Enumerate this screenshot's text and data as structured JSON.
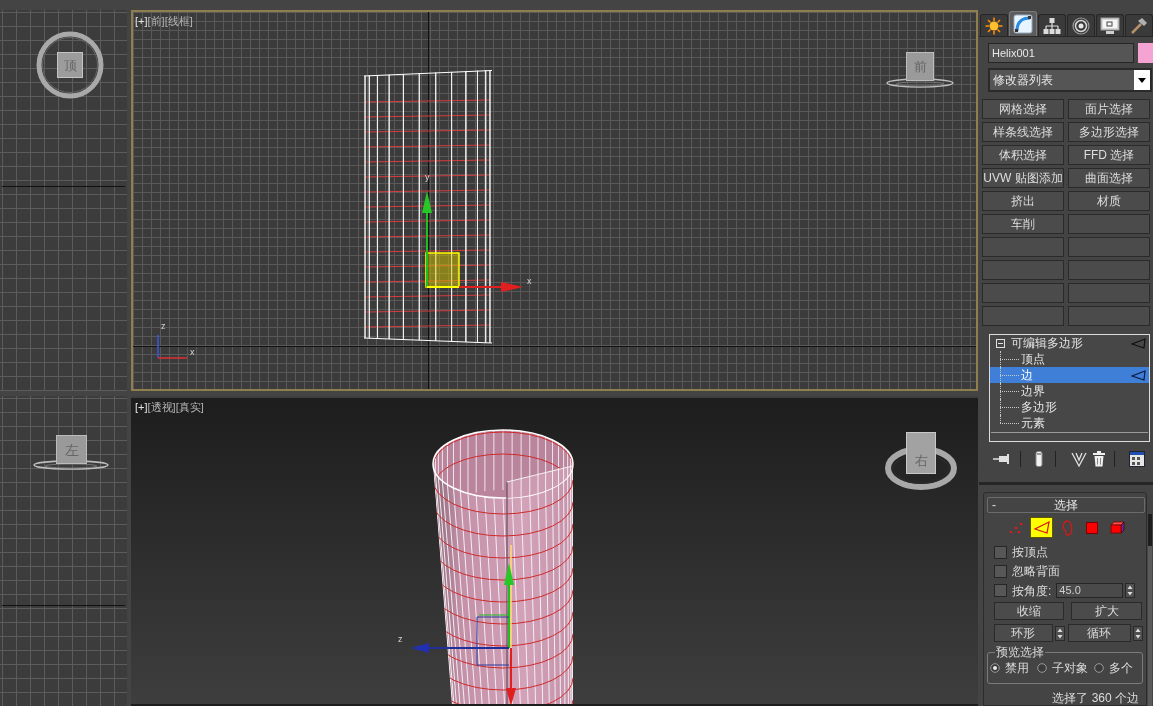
{
  "viewports": [
    {
      "kind": "top",
      "active": false,
      "viewcube_label": "顶"
    },
    {
      "kind": "front",
      "active": true,
      "menu_labels": [
        "[+]",
        "[前]",
        "[线框]"
      ],
      "viewcube_label": "前",
      "gizmo_labels": [
        "y",
        "x"
      ],
      "axis_labels": [
        "z",
        "x"
      ]
    },
    {
      "kind": "left",
      "active": false,
      "viewcube_label": "左"
    },
    {
      "kind": "perspective",
      "active": false,
      "menu_labels": [
        "[+]",
        "[透视]",
        "[真实]"
      ],
      "viewcube_label": "右",
      "gizmo_labels": [
        "z"
      ]
    }
  ],
  "command_panel": {
    "tabs": [
      {
        "kind": "create",
        "selected": false
      },
      {
        "kind": "modify",
        "selected": true
      },
      {
        "kind": "hierarchy",
        "selected": false
      },
      {
        "kind": "motion",
        "selected": false
      },
      {
        "kind": "display",
        "selected": false
      },
      {
        "kind": "utilities",
        "selected": false
      }
    ],
    "object": {
      "name": "Helix001",
      "color": "#f4a3d3"
    },
    "modifier_list": "修改器列表",
    "modifier_buttons": [
      "网格选择",
      "面片选择",
      "样条线选择",
      "多边形选择",
      "体积选择",
      "FFD 选择",
      "UVW 贴图添加",
      "曲面选择",
      "挤出",
      "材质",
      "车削"
    ],
    "modifier_stack": [
      {
        "label": "可编辑多边形",
        "expanded": true,
        "selected": false,
        "children": [
          {
            "label": "顶点",
            "selected": false
          },
          {
            "label": "边",
            "selected": true
          },
          {
            "label": "边界",
            "selected": false
          },
          {
            "label": "多边形",
            "selected": false
          },
          {
            "label": "元素",
            "selected": false
          }
        ]
      }
    ],
    "selection_rollout": {
      "toggle": "-",
      "title": "选择",
      "subobject_levels": [
        {
          "kind": "vertex",
          "selected": false
        },
        {
          "kind": "edge",
          "selected": true
        },
        {
          "kind": "border",
          "selected": false
        },
        {
          "kind": "polygon",
          "selected": false
        },
        {
          "kind": "element",
          "selected": false
        }
      ],
      "checkboxes": [
        {
          "label": "按顶点",
          "checked": false
        },
        {
          "label": "忽略背面",
          "checked": false
        }
      ],
      "by_angle": {
        "label": "按角度:",
        "checked": false,
        "value": "45.0"
      },
      "shrink_grow": [
        "收缩",
        "扩大"
      ],
      "ring_loop": [
        "环形",
        "循环"
      ],
      "preview": {
        "title": "预览选择",
        "options": [
          {
            "label": "禁用",
            "selected": true
          },
          {
            "label": "子对象",
            "selected": false
          },
          {
            "label": "多个",
            "selected": false
          }
        ]
      },
      "status": "选择了 360 个边"
    }
  }
}
